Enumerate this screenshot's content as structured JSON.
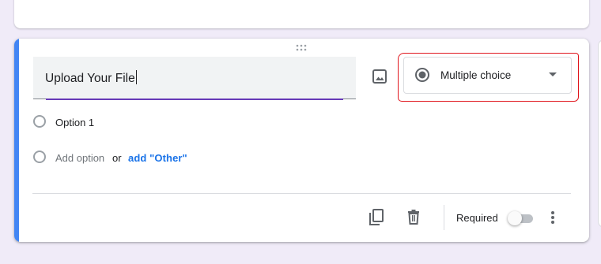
{
  "question": {
    "title_value": "Upload Your File",
    "type_selected": "Multiple choice"
  },
  "options": [
    {
      "label": "Option 1"
    }
  ],
  "add_option": {
    "label": "Add option",
    "or_text": "or",
    "other_link": "add \"Other\""
  },
  "footer": {
    "required_label": "Required",
    "required_on": false
  },
  "colors": {
    "accent_bar": "#4285f4",
    "focus_underline": "#673ab7",
    "link": "#1a73e8",
    "background": "#f0ebf8",
    "annotation": "#e0161d"
  },
  "icons": [
    "drag-handle-icon",
    "image-icon",
    "radio-button-icon",
    "dropdown-arrow-icon",
    "copy-icon",
    "delete-icon",
    "more-vert-icon"
  ]
}
